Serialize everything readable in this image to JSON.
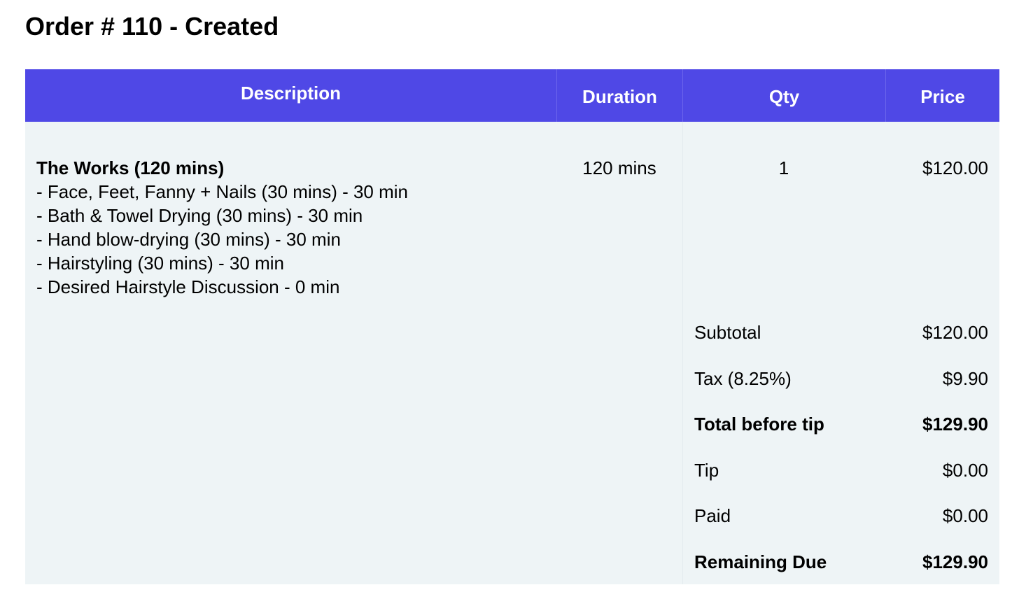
{
  "title": "Order # 110 - Created",
  "table": {
    "headers": {
      "description": "Description",
      "duration": "Duration",
      "qty": "Qty",
      "price": "Price"
    },
    "items": [
      {
        "name": "The Works (120 mins)",
        "sub_items": [
          "- Face, Feet, Fanny + Nails (30 mins) - 30 min",
          "- Bath & Towel Drying (30 mins) - 30 min",
          "- Hand blow-drying (30 mins) - 30 min",
          "- Hairstyling (30 mins) - 30 min",
          "- Desired Hairstyle Discussion - 0 min"
        ],
        "duration": "120 mins",
        "qty": "1",
        "price": "$120.00"
      }
    ]
  },
  "summary": {
    "subtotal": {
      "label": "Subtotal",
      "value": "$120.00"
    },
    "tax": {
      "label": "Tax (8.25%)",
      "value": "$9.90"
    },
    "total_before_tip": {
      "label": "Total before tip",
      "value": "$129.90"
    },
    "tip": {
      "label": "Tip",
      "value": "$0.00"
    },
    "paid": {
      "label": "Paid",
      "value": "$0.00"
    },
    "remaining_due": {
      "label": "Remaining Due",
      "value": "$129.90"
    }
  },
  "colors": {
    "header_background": "#4f48e6",
    "header_text": "#ffffff",
    "body_background": "#eef4f6"
  }
}
